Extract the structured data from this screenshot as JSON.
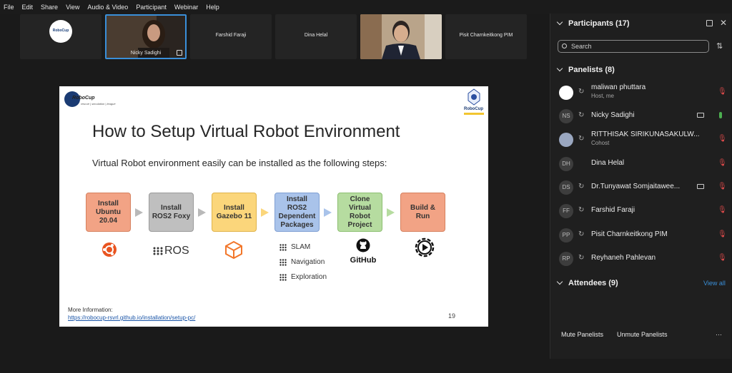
{
  "menu": [
    "File",
    "Edit",
    "Share",
    "View",
    "Audio & Video",
    "Participant",
    "Webinar",
    "Help"
  ],
  "thumbnails": {
    "robocup_logo": "RoboCup",
    "nicky": "Nicky Sadighi",
    "farshid": "Farshid Faraji",
    "dina": "Dina Helal",
    "pisit": "Pisit Charnkeitkong PIM"
  },
  "slide": {
    "logo_left": "RoboCup",
    "logo_left_sub": "rescue | simulation | league",
    "logo_right": "RoboCup",
    "title": "How to Setup Virtual Robot Environment",
    "subtitle": "Virtual Robot environment easily can be installed as the following steps:",
    "steps": [
      {
        "label": "Install Ubuntu 20.04",
        "lines": [
          "Install",
          "Ubuntu",
          "20.04"
        ],
        "color": "#f2a385",
        "border": "#d6815f"
      },
      {
        "label": "Install ROS2 Foxy",
        "lines": [
          "Install",
          "ROS2 Foxy"
        ],
        "color": "#bfbfbf",
        "border": "#9a9a9a"
      },
      {
        "label": "Install Gazebo 11",
        "lines": [
          "Install",
          "Gazebo 11"
        ],
        "color": "#fbd67b",
        "border": "#e0b34a"
      },
      {
        "label": "Install ROS2 Dependent Packages",
        "lines": [
          "Install",
          "ROS2",
          "Dependent",
          "Packages"
        ],
        "color": "#a9c3ea",
        "border": "#7f9fd3"
      },
      {
        "label": "Clone Virtual Robot Project",
        "lines": [
          "Clone",
          "Virtual",
          "Robot",
          "Project"
        ],
        "color": "#b6dca0",
        "border": "#8cbf70"
      },
      {
        "label": "Build & Run",
        "lines": [
          "Build &",
          "Run"
        ],
        "color": "#f2a385",
        "border": "#d6815f"
      }
    ],
    "ros_label": "ROS",
    "packages": [
      "SLAM",
      "Navigation",
      "Exploration"
    ],
    "github_label": "GitHub",
    "more_info": "More Information:",
    "link": "https://robocup-rsvrl.github.io/installation/setup-pc/",
    "page_number": "19"
  },
  "panel": {
    "header": "Participants (17)",
    "search_placeholder": "Search",
    "panelists_header": "Panelists (8)",
    "participants": [
      {
        "name": "maliwan phuttara",
        "sub": "Host, me",
        "initials": ""
      },
      {
        "name": "Nicky Sadighi",
        "sub": "",
        "initials": "NS"
      },
      {
        "name": "RITTHISAK SIRIKUNASAKULW...",
        "sub": "Cohost",
        "initials": ""
      },
      {
        "name": "Dina Helal",
        "sub": "",
        "initials": "DH"
      },
      {
        "name": "Dr.Tunyawat Somjaitawee...",
        "sub": "",
        "initials": "DS"
      },
      {
        "name": "Farshid Faraji",
        "sub": "",
        "initials": "FF"
      },
      {
        "name": "Pisit Charnkeitkong PIM",
        "sub": "",
        "initials": "PP"
      },
      {
        "name": "Reyhaneh Pahlevan",
        "sub": "",
        "initials": "RP"
      }
    ],
    "attendees_header": "Attendees (9)",
    "view_all": "View all",
    "mute_panelists": "Mute Panelists",
    "unmute_panelists": "Unmute Panelists",
    "more": "···"
  },
  "colors": {
    "accent": "#3a8fd9",
    "muted_red": "#e04b4b",
    "unmuted_green": "#4caf50",
    "link": "#1a55a8"
  }
}
